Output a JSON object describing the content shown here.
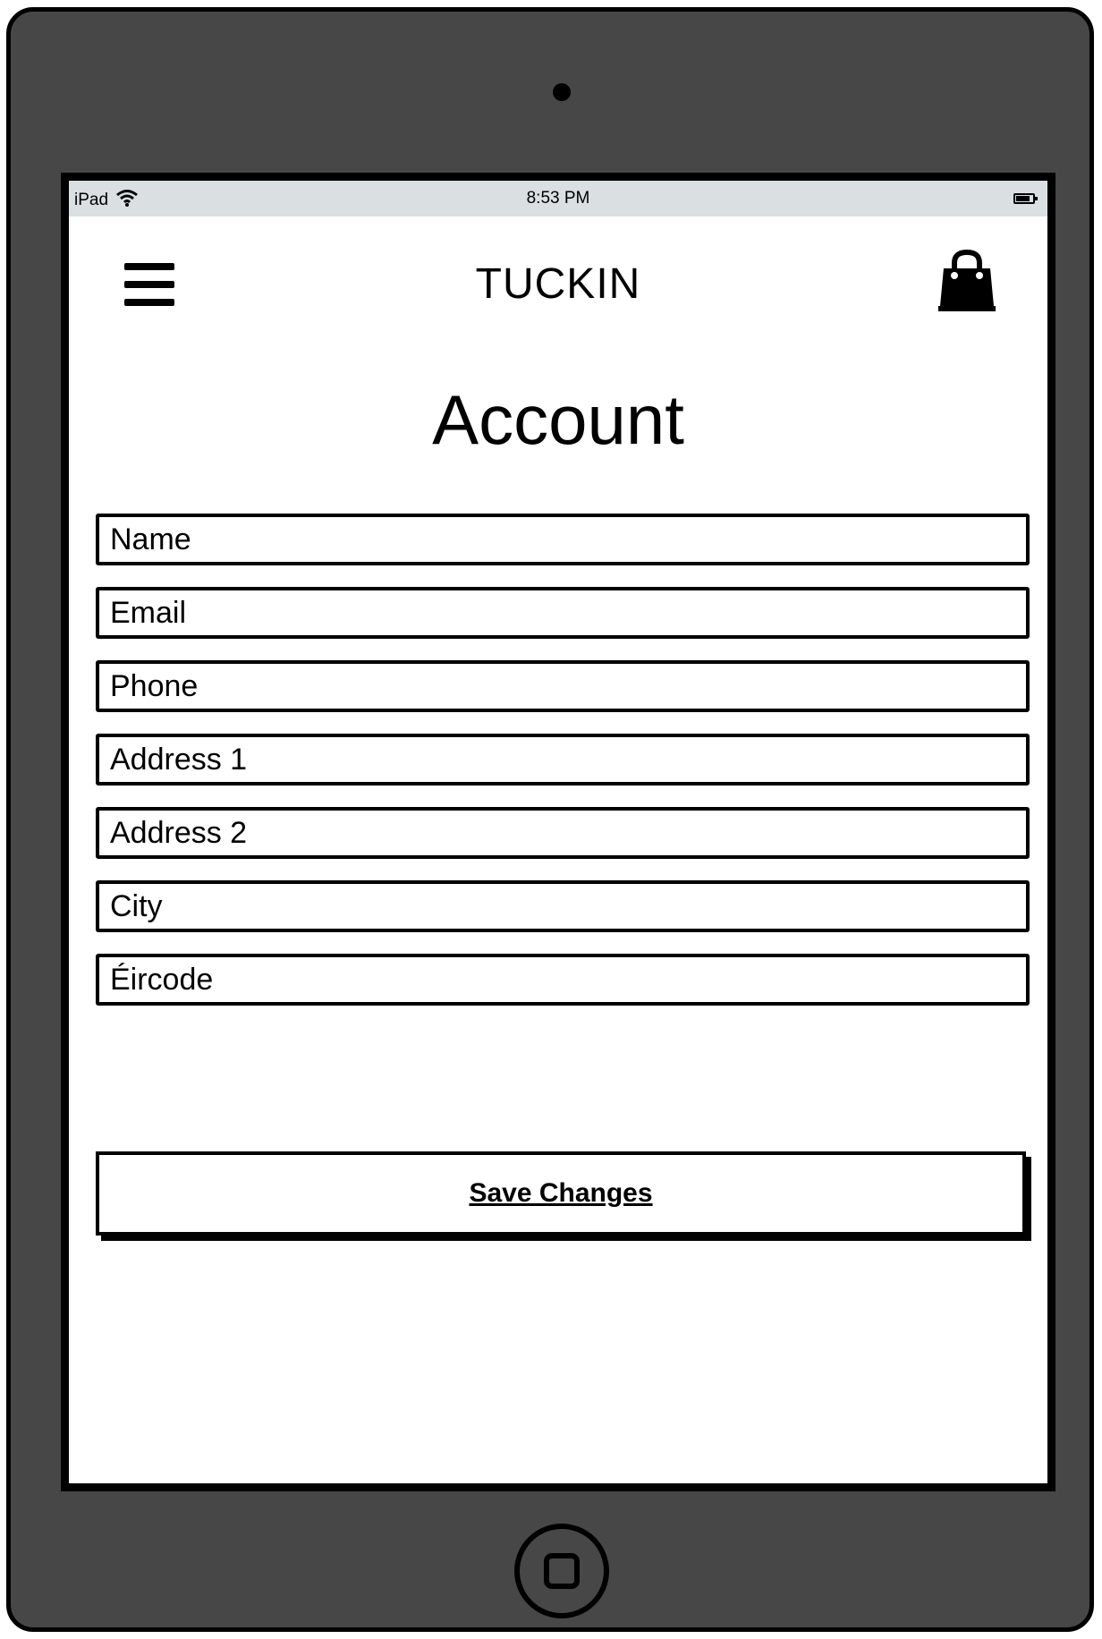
{
  "status_bar": {
    "device": "iPad",
    "time": "8:53 PM",
    "icons": [
      "wifi-icon",
      "battery-icon"
    ]
  },
  "header": {
    "brand": "TUCKIN",
    "menu_icon": "hamburger-menu-icon",
    "cart_icon": "shopping-bag-icon"
  },
  "page": {
    "title": "Account"
  },
  "form": {
    "fields": [
      {
        "placeholder": "Name",
        "value": ""
      },
      {
        "placeholder": "Email",
        "value": ""
      },
      {
        "placeholder": "Phone",
        "value": ""
      },
      {
        "placeholder": "Address 1",
        "value": ""
      },
      {
        "placeholder": "Address 2",
        "value": ""
      },
      {
        "placeholder": "City",
        "value": ""
      },
      {
        "placeholder": "Éircode",
        "value": ""
      }
    ],
    "save_label": "Save Changes"
  },
  "colors": {
    "device_frame": "#474747",
    "status_bar_bg": "#dadfe1",
    "screen_bg": "#ffffff",
    "ink": "#000000"
  }
}
